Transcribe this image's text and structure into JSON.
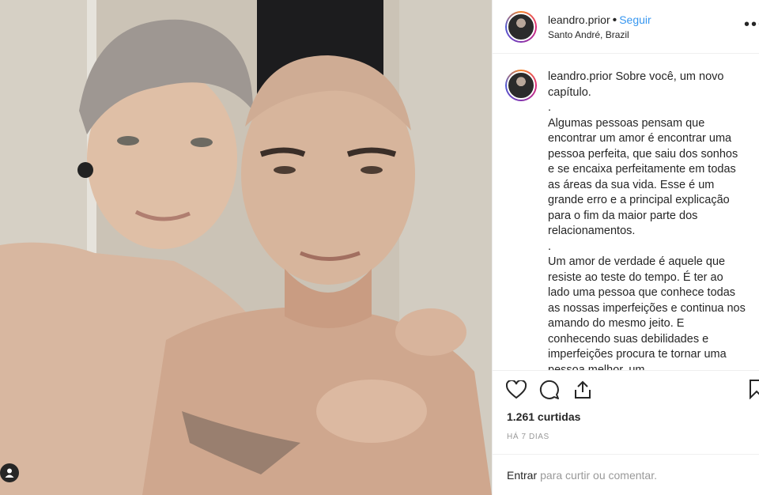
{
  "post": {
    "username": "leandro.prior",
    "follow_label": "Seguir",
    "location": "Santo André, Brazil",
    "caption_lines": [
      "Sobre você, um novo capítulo.",
      ".",
      "Algumas pessoas pensam que encontrar um amor é encontrar uma pessoa perfeita, que saiu dos sonhos e se encaixa perfeitamente em todas as áreas da sua vida. Esse é um grande erro e a principal explicação para o fim da maior parte dos relacionamentos.",
      ".",
      "Um amor de verdade é aquele que resiste ao teste do tempo. É ter ao lado uma pessoa que conhece todas as nossas imperfeições e continua nos amando do mesmo jeito. E conhecendo suas debilidades e imperfeições procura te tornar uma pessoa melhor, um"
    ],
    "likes": "1.261 curtidas",
    "time": "HÁ 7 DIAS"
  },
  "footer": {
    "login_label": "Entrar",
    "rest": "para curtir ou comentar."
  },
  "icons": [
    "heart-icon",
    "comment-icon",
    "share-icon",
    "bookmark-icon",
    "more-icon",
    "user-tag-icon"
  ],
  "colors": {
    "accent": "#3897f0",
    "text": "#262626",
    "muted": "#999999"
  }
}
